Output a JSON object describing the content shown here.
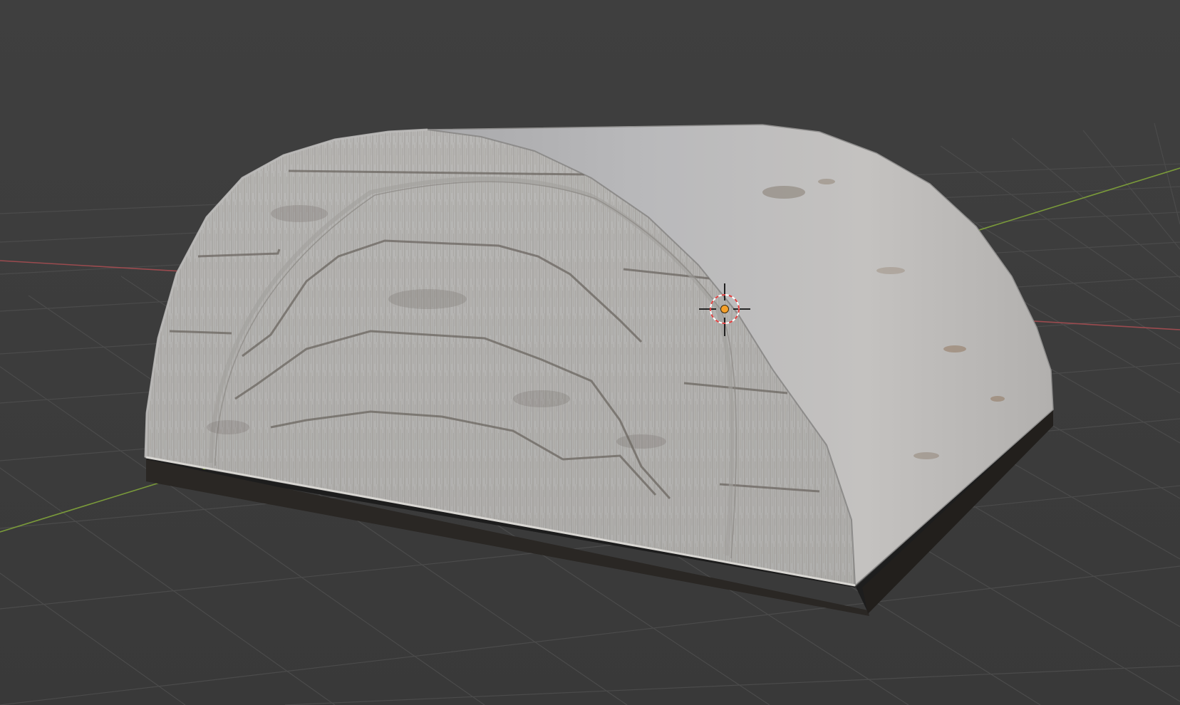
{
  "app": {
    "view": "3d-viewport",
    "shading": "material-preview"
  },
  "viewport": {
    "background_color": "#3d3d3d",
    "grid_line_color": "#4a4a4a",
    "x_axis_color": "#9b4b4f",
    "y_axis_color": "#7a9a3a",
    "show_grid": true,
    "show_axes": [
      "x",
      "y"
    ]
  },
  "scene": {
    "object": {
      "shape": "half-cylinder vault",
      "material": "concrete",
      "base_color": "#b4b4b6",
      "shadow_color": "#1e1e1e"
    },
    "cursor": {
      "icon": "3d-cursor-icon",
      "ring_colors": [
        "#e04040",
        "#ffffff"
      ],
      "center_color": "#f5a02a"
    }
  }
}
